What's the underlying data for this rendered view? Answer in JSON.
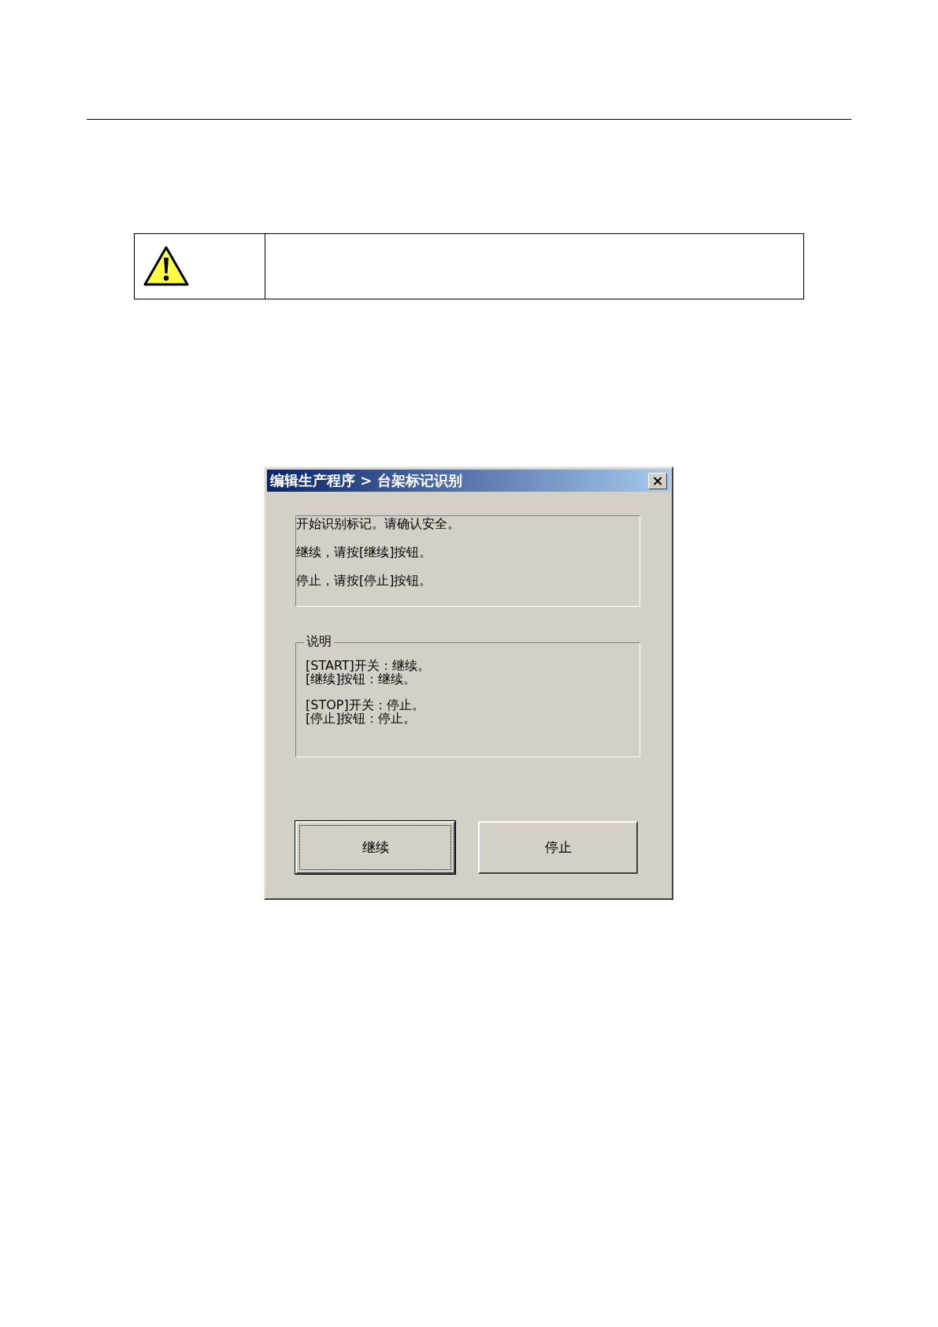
{
  "dialog": {
    "title": "编辑生产程序 > 台架标记识别",
    "close_label": "×",
    "message_lines": [
      "开始识别标记。请确认安全。",
      "继续，请按[继续]按钮。",
      "停止，请按[停止]按钮。"
    ],
    "group": {
      "title": "说明",
      "paragraphs": [
        [
          "[START]开关：继续。",
          "[继续]按钮：继续。"
        ],
        [
          "[STOP]开关：停止。",
          "[停止]按钮：停止。"
        ]
      ]
    },
    "buttons": [
      {
        "label": "继续",
        "focused": true
      },
      {
        "label": "停止",
        "focused": false
      }
    ]
  }
}
